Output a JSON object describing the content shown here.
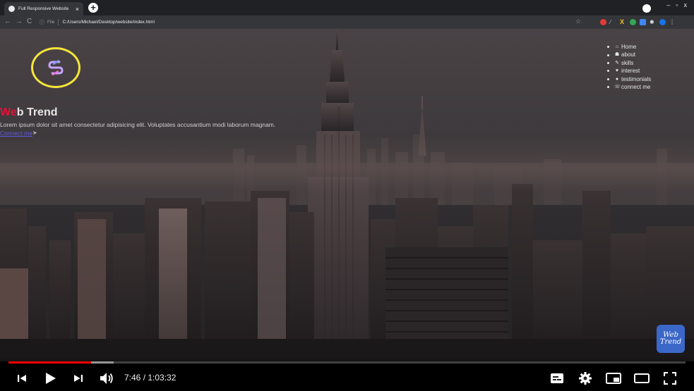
{
  "browser": {
    "tab_title": "Full Responsive Website",
    "url_scheme": "File",
    "url": "C:/Users/Michael/Desktop/website/index.html"
  },
  "site": {
    "title_accent": "We",
    "title_rest": "b Trend",
    "paragraph": "Lorem ipsum dolor sit amet consectetur adipisicing elit. Voluptates accusantium modi laborum magnam.",
    "link_text": "Connect me",
    "nav": [
      {
        "label": "Home",
        "icon": "home-icon"
      },
      {
        "label": "about",
        "icon": "user-edit-icon"
      },
      {
        "label": "skills",
        "icon": "wrench-icon"
      },
      {
        "label": "interest",
        "icon": "heart-icon"
      },
      {
        "label": "testimonials",
        "icon": "comment-icon"
      },
      {
        "label": "connect me",
        "icon": "phone-icon"
      }
    ],
    "watermark_line1": "Web",
    "watermark_line2": "Trend"
  },
  "player": {
    "current_time": "7:46",
    "duration": "1:03:32",
    "time_display": "7:46 / 1:03:32",
    "progress_fraction": 0.122,
    "buffered_fraction": 0.155
  },
  "colors": {
    "accent_red": "#e3113a",
    "progress_red": "#ff0000",
    "highlight_yellow": "#f6e53a",
    "link_blue": "#5a5ae8"
  }
}
